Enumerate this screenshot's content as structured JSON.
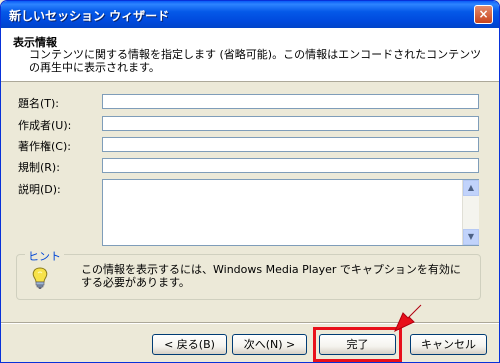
{
  "window": {
    "title": "新しいセッション ウィザード",
    "close_label": "×"
  },
  "header": {
    "title": "表示情報",
    "description": "コンテンツに関する情報を指定します (省略可能)。この情報はエンコードされたコンテンツの再生中に表示されます。"
  },
  "fields": {
    "title_label": "題名(T):",
    "author_label": "作成者(U):",
    "copyright_label": "著作権(C):",
    "rating_label": "規制(R):",
    "description_label": "説明(D):",
    "title_value": "",
    "author_value": "",
    "copyright_value": "",
    "rating_value": "",
    "description_value": ""
  },
  "hint": {
    "label": "ヒント",
    "text": "この情報を表示するには、Windows Media Player でキャプションを有効にする必要があります。"
  },
  "buttons": {
    "back": "< 戻る(B)",
    "next": "次へ(N) >",
    "finish": "完了",
    "cancel": "キャンセル"
  },
  "colors": {
    "highlight": "#e8101a",
    "titlebar": "#0049dd",
    "hint_label": "#0046d5"
  },
  "icons": {
    "hint": "lightbulb-icon",
    "pointer": "red-arrow-icon",
    "close": "close-icon"
  }
}
